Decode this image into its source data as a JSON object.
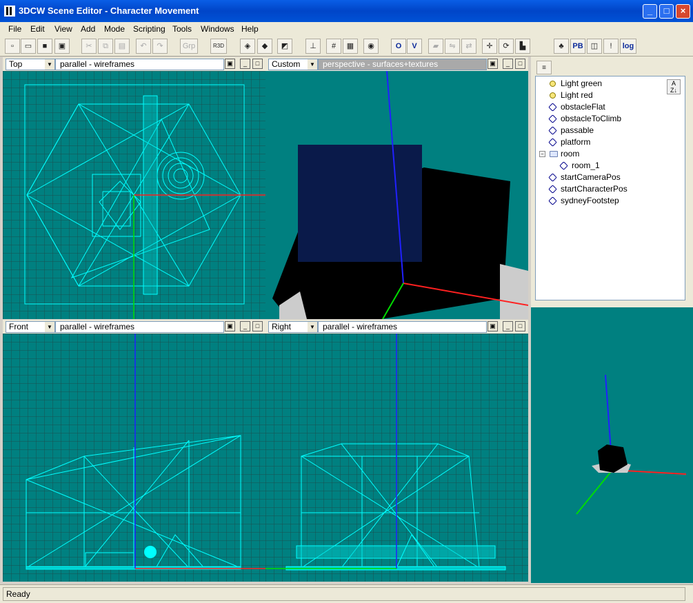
{
  "window": {
    "title": "3DCW Scene Editor - Character Movement"
  },
  "menu": [
    "File",
    "Edit",
    "View",
    "Add",
    "Mode",
    "Scripting",
    "Tools",
    "Windows",
    "Help"
  ],
  "toolbar": {
    "grp_label": "Grp",
    "o_label": "O",
    "v_label": "V",
    "pb_label": "PB",
    "log_label": "log"
  },
  "viewports": {
    "top": {
      "view": "Top",
      "mode": "parallel - wireframes"
    },
    "custom": {
      "view": "Custom",
      "mode": "perspective - surfaces+textures"
    },
    "front": {
      "view": "Front",
      "mode": "parallel - wireframes"
    },
    "right": {
      "view": "Right",
      "mode": "parallel - wireframes"
    }
  },
  "scene_tree": [
    {
      "label": "Light green",
      "icon": "light-icon"
    },
    {
      "label": "Light red",
      "icon": "light-icon"
    },
    {
      "label": "obstacleFlat",
      "icon": "object-icon"
    },
    {
      "label": "obstacleToClimb",
      "icon": "object-icon"
    },
    {
      "label": "passable",
      "icon": "object-icon"
    },
    {
      "label": "platform",
      "icon": "object-icon"
    },
    {
      "label": "room",
      "icon": "folder-icon"
    },
    {
      "label": "room_1",
      "icon": "object-icon"
    },
    {
      "label": "startCameraPos",
      "icon": "object-icon"
    },
    {
      "label": "startCharacterPos",
      "icon": "object-icon"
    },
    {
      "label": "sydneyFootstep",
      "icon": "object-icon"
    }
  ],
  "status": {
    "text": "Ready"
  }
}
